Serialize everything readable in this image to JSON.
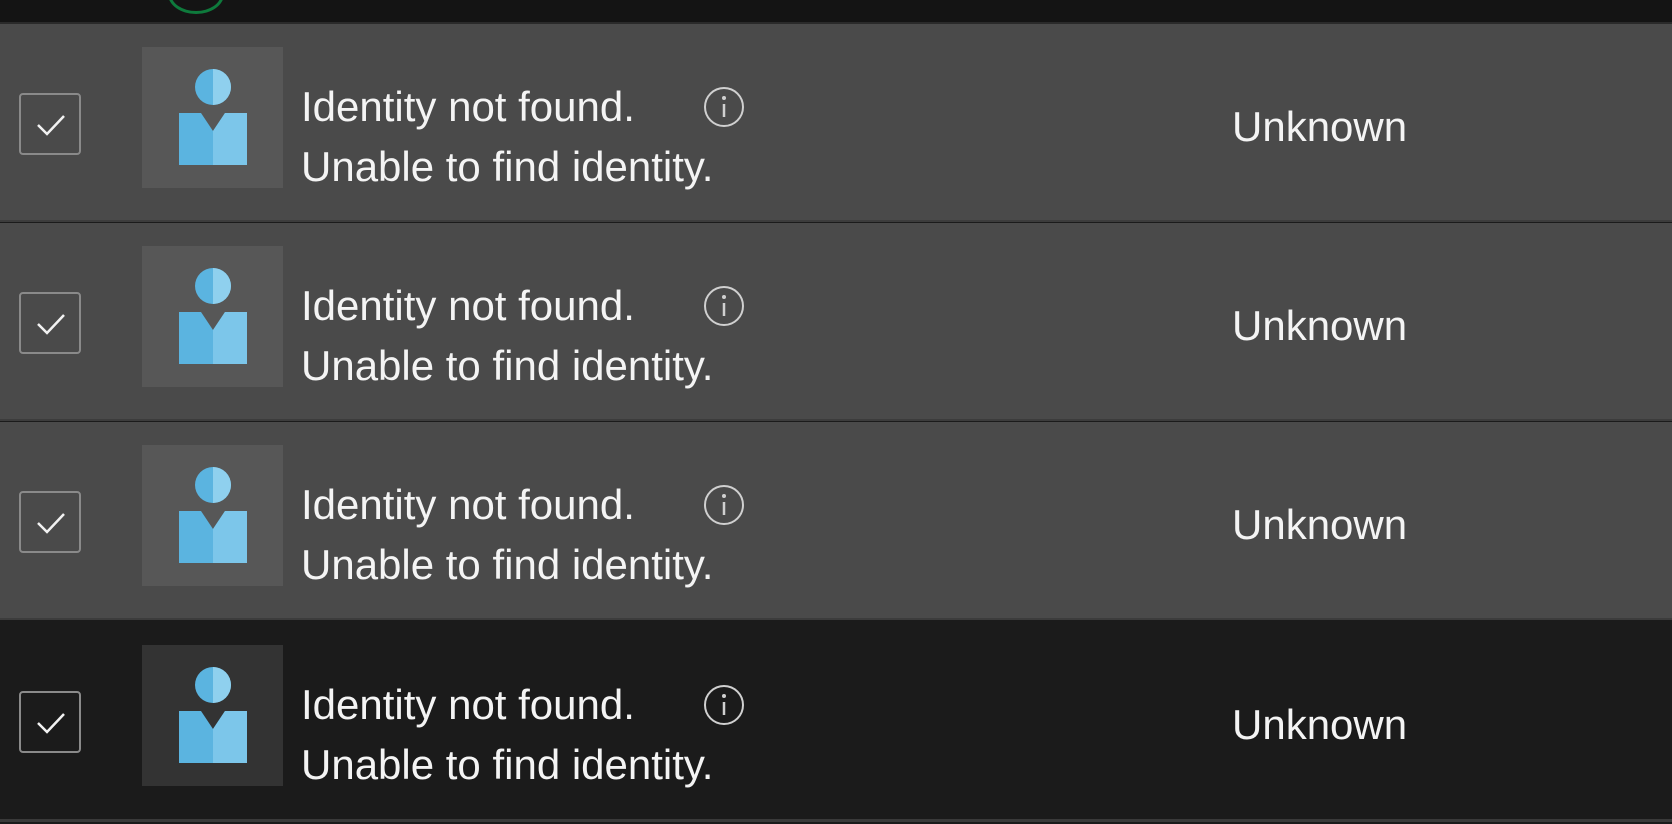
{
  "colors": {
    "selected_row_bg": "#4a4a4a",
    "plain_row_bg": "#1b1b1b",
    "avatar_accent": "#5bb4e0",
    "text": "#f4f4f4"
  },
  "rows": [
    {
      "checked": true,
      "avatar_icon": "generic-person-icon",
      "title": "Identity not found.",
      "subtitle": "Unable to find identity.",
      "info_icon": "info-icon",
      "status": "Unknown"
    },
    {
      "checked": true,
      "avatar_icon": "generic-person-icon",
      "title": "Identity not found.",
      "subtitle": "Unable to find identity.",
      "info_icon": "info-icon",
      "status": "Unknown"
    },
    {
      "checked": true,
      "avatar_icon": "generic-person-icon",
      "title": "Identity not found.",
      "subtitle": "Unable to find identity.",
      "info_icon": "info-icon",
      "status": "Unknown"
    },
    {
      "checked": true,
      "avatar_icon": "generic-person-icon",
      "title": "Identity not found.",
      "subtitle": "Unable to find identity.",
      "info_icon": "info-icon",
      "status": "Unknown"
    }
  ]
}
